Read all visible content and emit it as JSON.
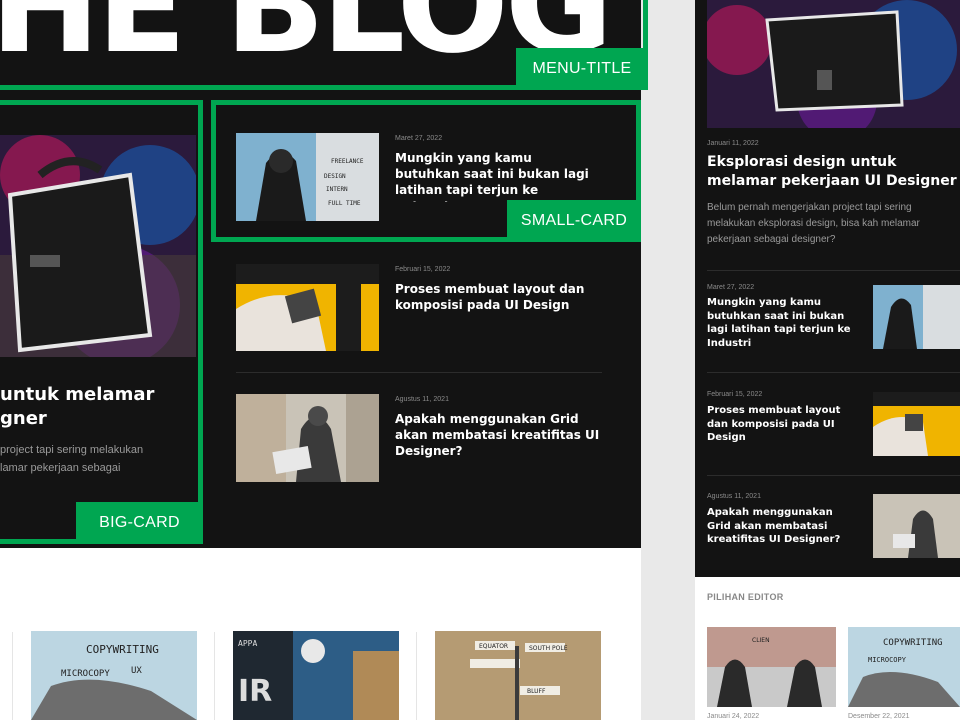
{
  "hero": {
    "text": "HE BLOG"
  },
  "labels": {
    "menu_title": "MENU-TITLE",
    "small_card": "SMALL-CARD",
    "big_card": "BIG-CARD"
  },
  "big_card": {
    "title": "untuk melamar\ngner",
    "desc": "project tapi sering melakukan\nlamar pekerjaan sebagai"
  },
  "small_cards": [
    {
      "date": "Maret 27, 2022",
      "title": "Mungkin yang kamu butuhkan saat ini bukan lagi latihan tapi terjun ke Industri"
    },
    {
      "date": "Februari 15, 2022",
      "title": "Proses membuat layout dan komposisi pada UI Design"
    },
    {
      "date": "Agustus 11, 2021",
      "title": "Apakah menggunakan Grid akan membatasi kreatifitas UI Designer?"
    }
  ],
  "mobile": {
    "featured": {
      "date": "Januari 11, 2022",
      "title": "Eksplorasi design untuk melamar pekerjaan UI Designer",
      "desc": "Belum pernah mengerjakan project tapi sering melakukan eksplorasi design, bisa kah melamar pekerjaan sebagai designer?"
    },
    "items": [
      {
        "date": "Maret 27, 2022",
        "title": "Mungkin yang kamu butuhkan saat ini bukan lagi latihan tapi terjun ke Industri"
      },
      {
        "date": "Februari 15, 2022",
        "title": "Proses membuat layout dan komposisi pada UI Design"
      },
      {
        "date": "Agustus 11, 2021",
        "title": "Apakah menggunakan Grid akan membatasi kreatifitas UI Designer?"
      }
    ],
    "editor_label": "PILIHAN EDITOR",
    "editor_dates": [
      "Januari 24, 2022",
      "Desember 22, 2021"
    ]
  },
  "colors": {
    "accent": "#00a651",
    "dark": "#131313",
    "text": "#ffffff"
  }
}
